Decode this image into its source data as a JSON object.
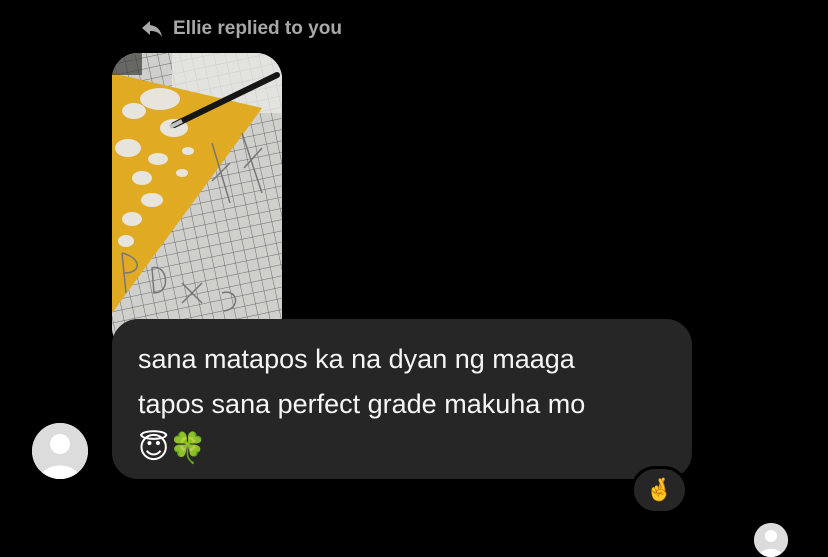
{
  "reply": {
    "header_text": "Ellie replied to you",
    "icon": "reply-arrow-icon"
  },
  "message": {
    "lines": [
      "sana matapos ka na dyan ng maaga",
      "tapos sana perfect grade makuha mo"
    ],
    "emojis": "😇🍀"
  },
  "reaction": {
    "emoji": "🤞"
  },
  "photo": {
    "description_icon": "photo-attachment"
  },
  "colors": {
    "background": "#000000",
    "bubble": "#262626",
    "header_text": "#a8a8a8",
    "message_text": "#f5f5f5"
  }
}
